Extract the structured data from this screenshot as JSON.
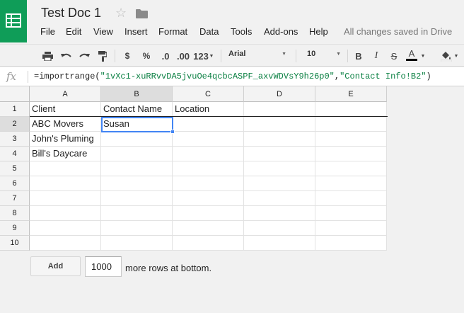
{
  "app": {
    "doc_title": "Test Doc 1",
    "brand_color": "#0f9d58",
    "status": "All changes saved in Drive"
  },
  "menu": [
    {
      "label": "File"
    },
    {
      "label": "Edit"
    },
    {
      "label": "View"
    },
    {
      "label": "Insert"
    },
    {
      "label": "Format"
    },
    {
      "label": "Data"
    },
    {
      "label": "Tools"
    },
    {
      "label": "Add-ons"
    },
    {
      "label": "Help"
    }
  ],
  "toolbar": {
    "currency": "$",
    "percent": "%",
    "decrease_decimals": ".0",
    "increase_decimals": ".00",
    "more_formats": "123",
    "font": "Arial",
    "font_size": "10",
    "bold": "B",
    "italic": "I",
    "strikethrough": "S",
    "text_color": "A",
    "icons": [
      "print-icon",
      "undo-icon",
      "redo-icon",
      "paint-format-icon",
      "fill-color-icon"
    ]
  },
  "formula_bar": {
    "fx_label": "fx",
    "prefix": "=importrange(",
    "arg1": "\"1vXc1-xuRRvvDA5jvuOe4qcbcASPF_axvWDVsY9h26p0\"",
    "comma": ",",
    "arg2": "\"Contact Info!B2\"",
    "suffix": ")",
    "string_color": "#0b8043"
  },
  "grid": {
    "columns": [
      "A",
      "B",
      "C",
      "D",
      "E"
    ],
    "rows": [
      "1",
      "2",
      "3",
      "4",
      "5",
      "6",
      "7",
      "8",
      "9",
      "10"
    ],
    "cells": [
      [
        "Client",
        "Contact Name",
        "Location",
        "",
        ""
      ],
      [
        "ABC Movers",
        "Susan",
        "",
        "",
        ""
      ],
      [
        "John's Pluming",
        "",
        "",
        "",
        ""
      ],
      [
        "Bill's Daycare",
        "",
        "",
        "",
        ""
      ],
      [
        "",
        "",
        "",
        "",
        ""
      ],
      [
        "",
        "",
        "",
        "",
        ""
      ],
      [
        "",
        "",
        "",
        "",
        ""
      ],
      [
        "",
        "",
        "",
        "",
        ""
      ],
      [
        "",
        "",
        "",
        "",
        ""
      ],
      [
        "",
        "",
        "",
        "",
        ""
      ]
    ],
    "selected_cell": "B2",
    "selection_color": "#4285f4"
  },
  "bottom": {
    "add_label": "Add",
    "rows_value": "1000",
    "rows_suffix": "more rows at bottom."
  }
}
